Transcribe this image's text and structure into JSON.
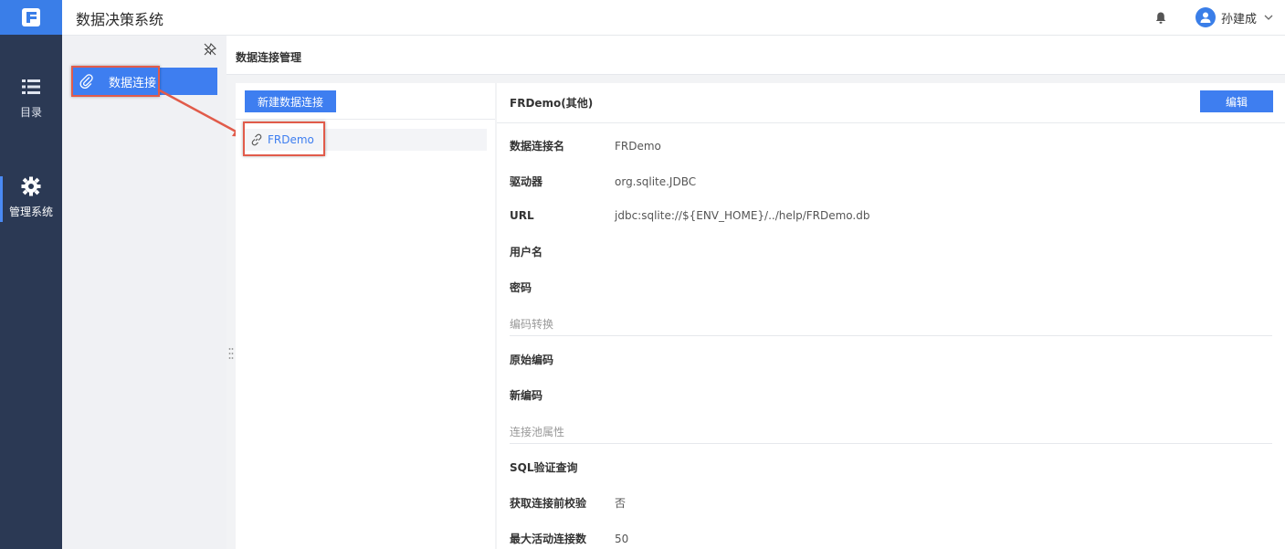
{
  "app": {
    "title": "数据决策系统"
  },
  "rail": {
    "items": [
      {
        "label": "目录",
        "icon": "list-icon"
      },
      {
        "label": "管理系统",
        "icon": "gear-icon"
      }
    ]
  },
  "header": {
    "user_name": "孙建成",
    "icons": [
      "bell-icon",
      "user-avatar-icon",
      "chevron-down-icon"
    ]
  },
  "submenu": {
    "items": [
      {
        "label": "数据连接",
        "icon": "paperclip-icon"
      }
    ],
    "pin_icon": "unpin-icon"
  },
  "page": {
    "title": "数据连接管理"
  },
  "list": {
    "new_button": "新建数据连接",
    "items": [
      {
        "label": "FRDemo",
        "icon": "link-icon"
      }
    ]
  },
  "detail": {
    "title": "FRDemo(其他)",
    "edit_button": "编辑",
    "fields": [
      {
        "label": "数据连接名",
        "value": "FRDemo"
      },
      {
        "label": "驱动器",
        "value": "org.sqlite.JDBC"
      },
      {
        "label": "URL",
        "value": "jdbc:sqlite://${ENV_HOME}/../help/FRDemo.db"
      },
      {
        "label": "用户名",
        "value": ""
      },
      {
        "label": "密码",
        "value": ""
      }
    ],
    "section_encoding": "编码转换",
    "encoding_fields": [
      {
        "label": "原始编码",
        "value": ""
      },
      {
        "label": "新编码",
        "value": ""
      }
    ],
    "section_pool": "连接池属性",
    "pool_fields": [
      {
        "label": "SQL验证查询",
        "value": ""
      },
      {
        "label": "获取连接前校验",
        "value": "否"
      },
      {
        "label": "最大活动连接数",
        "value": "50"
      }
    ]
  },
  "colors": {
    "accent": "#3e7ef0",
    "rail": "#2b3954",
    "highlight": "#e15b4a"
  }
}
